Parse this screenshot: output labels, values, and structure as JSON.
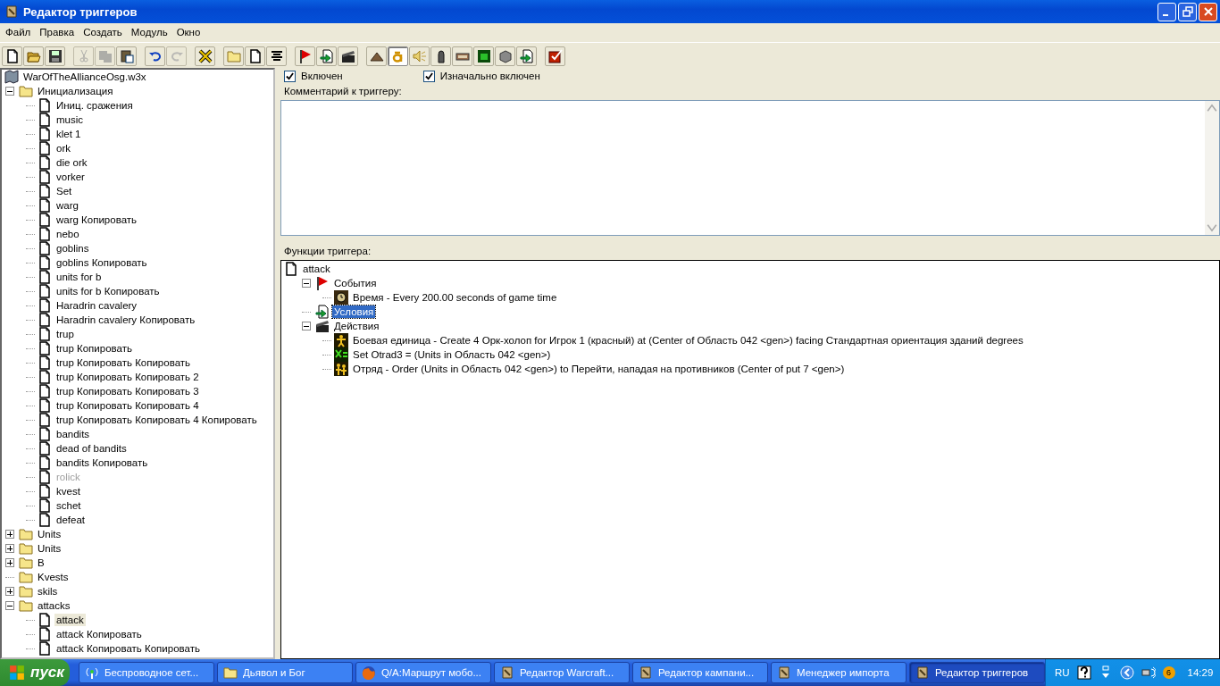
{
  "window": {
    "title": "Редактор триггеров"
  },
  "menu": [
    "Файл",
    "Правка",
    "Создать",
    "Модуль",
    "Окно"
  ],
  "toolbar": [
    {
      "kind": "new",
      "disabled": false,
      "pressed": false
    },
    {
      "kind": "open",
      "disabled": false,
      "pressed": false
    },
    {
      "kind": "save",
      "disabled": false,
      "pressed": false
    },
    {
      "kind": "cut",
      "disabled": true,
      "pressed": false
    },
    {
      "kind": "copy",
      "disabled": true,
      "pressed": false
    },
    {
      "kind": "paste",
      "disabled": false,
      "pressed": false
    },
    {
      "kind": "undo",
      "disabled": false,
      "pressed": false
    },
    {
      "kind": "redo",
      "disabled": true,
      "pressed": false
    },
    {
      "kind": "x",
      "disabled": false,
      "pressed": false
    },
    {
      "kind": "category",
      "disabled": false,
      "pressed": false
    },
    {
      "kind": "trigger",
      "disabled": false,
      "pressed": false
    },
    {
      "kind": "comment",
      "disabled": false,
      "pressed": false
    },
    {
      "kind": "event",
      "disabled": false,
      "pressed": false
    },
    {
      "kind": "condition",
      "disabled": false,
      "pressed": false
    },
    {
      "kind": "action",
      "disabled": false,
      "pressed": false
    },
    {
      "kind": "terrain",
      "disabled": false,
      "pressed": false
    },
    {
      "kind": "ai",
      "disabled": false,
      "pressed": true
    },
    {
      "kind": "sound",
      "disabled": false,
      "pressed": false
    },
    {
      "kind": "object",
      "disabled": false,
      "pressed": false
    },
    {
      "kind": "campaign",
      "disabled": false,
      "pressed": false
    },
    {
      "kind": "unit",
      "disabled": false,
      "pressed": false
    },
    {
      "kind": "cube",
      "disabled": false,
      "pressed": false
    },
    {
      "kind": "import",
      "disabled": false,
      "pressed": false
    },
    {
      "kind": "test",
      "disabled": false,
      "pressed": false
    }
  ],
  "tree": {
    "label": "WarOfTheAllianceOsg.w3x",
    "children": [
      {
        "kind": "folder",
        "label": "Инициализация",
        "expanded": true,
        "children": [
          {
            "kind": "trigger",
            "label": "Иниц. сражения",
            "disabled": false,
            "selected": false
          },
          {
            "kind": "trigger",
            "label": "music",
            "disabled": false,
            "selected": false
          },
          {
            "kind": "trigger",
            "label": "klet 1",
            "disabled": false,
            "selected": false
          },
          {
            "kind": "trigger",
            "label": "ork",
            "disabled": false,
            "selected": false
          },
          {
            "kind": "trigger",
            "label": "die ork",
            "disabled": false,
            "selected": false
          },
          {
            "kind": "trigger",
            "label": "vorker",
            "disabled": false,
            "selected": false
          },
          {
            "kind": "trigger",
            "label": "Set",
            "disabled": false,
            "selected": false
          },
          {
            "kind": "trigger",
            "label": "warg",
            "disabled": false,
            "selected": false
          },
          {
            "kind": "trigger",
            "label": "warg Копировать",
            "disabled": false,
            "selected": false
          },
          {
            "kind": "trigger",
            "label": "nebo",
            "disabled": false,
            "selected": false
          },
          {
            "kind": "trigger",
            "label": "goblins",
            "disabled": false,
            "selected": false
          },
          {
            "kind": "trigger",
            "label": "goblins Копировать",
            "disabled": false,
            "selected": false
          },
          {
            "kind": "trigger",
            "label": "units for b",
            "disabled": false,
            "selected": false
          },
          {
            "kind": "trigger",
            "label": "units for b Копировать",
            "disabled": false,
            "selected": false
          },
          {
            "kind": "trigger",
            "label": "Haradrin cavalery",
            "disabled": false,
            "selected": false
          },
          {
            "kind": "trigger",
            "label": "Haradrin cavalery Копировать",
            "disabled": false,
            "selected": false
          },
          {
            "kind": "trigger",
            "label": "trup",
            "disabled": false,
            "selected": false
          },
          {
            "kind": "trigger",
            "label": "trup Копировать",
            "disabled": false,
            "selected": false
          },
          {
            "kind": "trigger",
            "label": "trup Копировать Копировать",
            "disabled": false,
            "selected": false
          },
          {
            "kind": "trigger",
            "label": "trup Копировать Копировать 2",
            "disabled": false,
            "selected": false
          },
          {
            "kind": "trigger",
            "label": "trup Копировать Копировать 3",
            "disabled": false,
            "selected": false
          },
          {
            "kind": "trigger",
            "label": "trup Копировать Копировать 4",
            "disabled": false,
            "selected": false
          },
          {
            "kind": "trigger",
            "label": "trup Копировать Копировать 4 Копировать",
            "disabled": false,
            "selected": false
          },
          {
            "kind": "trigger",
            "label": "bandits",
            "disabled": false,
            "selected": false
          },
          {
            "kind": "trigger",
            "label": "dead of bandits",
            "disabled": false,
            "selected": false
          },
          {
            "kind": "trigger",
            "label": "bandits Копировать",
            "disabled": false,
            "selected": false
          },
          {
            "kind": "trigger",
            "label": "rolick",
            "disabled": true,
            "selected": false
          },
          {
            "kind": "trigger",
            "label": "kvest",
            "disabled": false,
            "selected": false
          },
          {
            "kind": "trigger",
            "label": "schet",
            "disabled": false,
            "selected": false
          },
          {
            "kind": "trigger",
            "label": "defeat",
            "disabled": false,
            "selected": false
          }
        ]
      },
      {
        "kind": "folder",
        "label": "Units",
        "expanded": false
      },
      {
        "kind": "folder",
        "label": "Units",
        "expanded": false
      },
      {
        "kind": "folder",
        "label": "B",
        "expanded": false
      },
      {
        "kind": "folder",
        "label": "Kvests"
      },
      {
        "kind": "folder",
        "label": "skils",
        "expanded": false
      },
      {
        "kind": "folder",
        "label": "attacks",
        "expanded": true,
        "children": [
          {
            "kind": "trigger",
            "label": "attack",
            "disabled": false,
            "selected": true
          },
          {
            "kind": "trigger",
            "label": "attack Копировать",
            "disabled": false,
            "selected": false
          },
          {
            "kind": "trigger",
            "label": "attack Копировать Копировать",
            "disabled": false,
            "selected": false
          }
        ]
      }
    ]
  },
  "options": [
    {
      "label": "Включен",
      "checked": true
    },
    {
      "label": "Изначально включен",
      "checked": true
    }
  ],
  "comment": {
    "label": "Комментарий к триггеру:"
  },
  "functions": {
    "label": "Функции триггера:",
    "root": "attack",
    "children": [
      {
        "kind": "events",
        "label": "События",
        "expanded": true,
        "selected": false,
        "children": [
          {
            "kind": "time",
            "label": "Время - Every 200.00 seconds of game time",
            "selected": false
          }
        ]
      },
      {
        "kind": "conditions",
        "label": "Условия",
        "selected": true
      },
      {
        "kind": "actions",
        "label": "Действия",
        "expanded": true,
        "selected": false,
        "children": [
          {
            "kind": "unit",
            "label": "Боевая единица - Create 4 Орк-холоп for Игрок 1 (красный) at (Center of Область 042 <gen>) facing Стандартная ориентация зданий degrees",
            "selected": false
          },
          {
            "kind": "set",
            "label": "Set Otrad3 = (Units in Область 042 <gen>)",
            "selected": false
          },
          {
            "kind": "group",
            "label": "Отряд - Order (Units in Область 042 <gen>) to Перейти, нападая на противников (Center of put 7 <gen>)",
            "selected": false
          }
        ]
      }
    ]
  },
  "taskbar": {
    "start": "пуск",
    "tasks": [
      {
        "kind": "wireless",
        "label": "Беспроводное сет...",
        "selected": false
      },
      {
        "kind": "folder",
        "label": "Дьявол и Бог",
        "selected": false
      },
      {
        "kind": "browser",
        "label": "Q/A:Маршрут мобо...",
        "selected": false
      },
      {
        "kind": "editor",
        "label": "Редактор Warcraft...",
        "selected": false
      },
      {
        "kind": "editor",
        "label": "Редактор кампани...",
        "selected": false
      },
      {
        "kind": "editor",
        "label": "Менеджер импорта",
        "selected": false
      },
      {
        "kind": "editor",
        "label": "Редактор триггеров",
        "selected": true
      }
    ],
    "language": "RU",
    "badge": "6",
    "clock": "14:29"
  }
}
